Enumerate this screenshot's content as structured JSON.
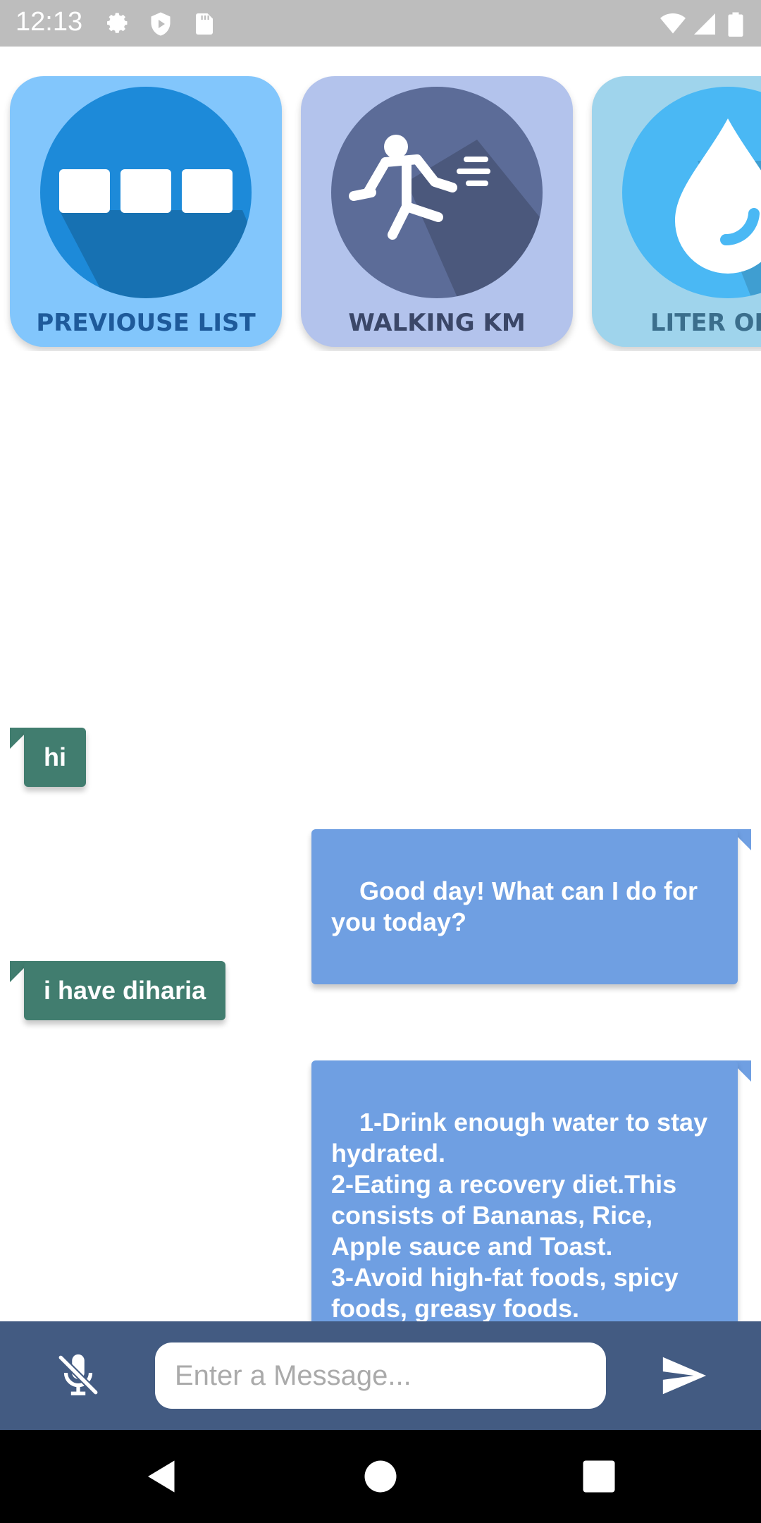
{
  "status_bar": {
    "time": "12:13",
    "icons": [
      "gear-icon",
      "play-protect-icon",
      "sd-card-icon",
      "wifi-icon",
      "signal-icon",
      "battery-icon"
    ]
  },
  "cards": [
    {
      "label": "PREVIOUSE LIST",
      "icon": "list-blocks-icon",
      "bg": "#82c6fc",
      "circle": "#1d8ad9",
      "label_color": "#1e5a9a"
    },
    {
      "label": "WALKING KM",
      "icon": "running-person-icon",
      "bg": "#b3c3ec",
      "circle": "#5c6c98",
      "label_color": "#3b4768"
    },
    {
      "label": "LITER OF W",
      "icon": "water-drop-icon",
      "bg": "#9fd4ec",
      "circle": "#4ab8f4",
      "label_color": "#3b6e8c"
    }
  ],
  "messages": [
    {
      "sender": "user",
      "text": "hi"
    },
    {
      "sender": "bot",
      "text": "Good day! What can I do for you today?"
    },
    {
      "sender": "user",
      "text": "i have diharia"
    },
    {
      "sender": "bot",
      "text": "1-Drink enough water to stay hydrated.\n2-Eating a recovery diet.This consists of Bananas, Rice, Apple sauce and Toast.\n3-Avoid high-fat foods, spicy foods, greasy foods."
    }
  ],
  "input": {
    "placeholder": "Enter a Message...",
    "value": "",
    "mic_icon": "mic-off-icon",
    "send_icon": "send-icon"
  },
  "nav": [
    "back-icon",
    "home-icon",
    "recents-icon"
  ],
  "colors": {
    "status_bar": "#bdbdbd",
    "user_bubble": "#417d6f",
    "bot_bubble": "#6f9fe2",
    "input_bar": "#435b82",
    "nav_bar": "#000000"
  }
}
